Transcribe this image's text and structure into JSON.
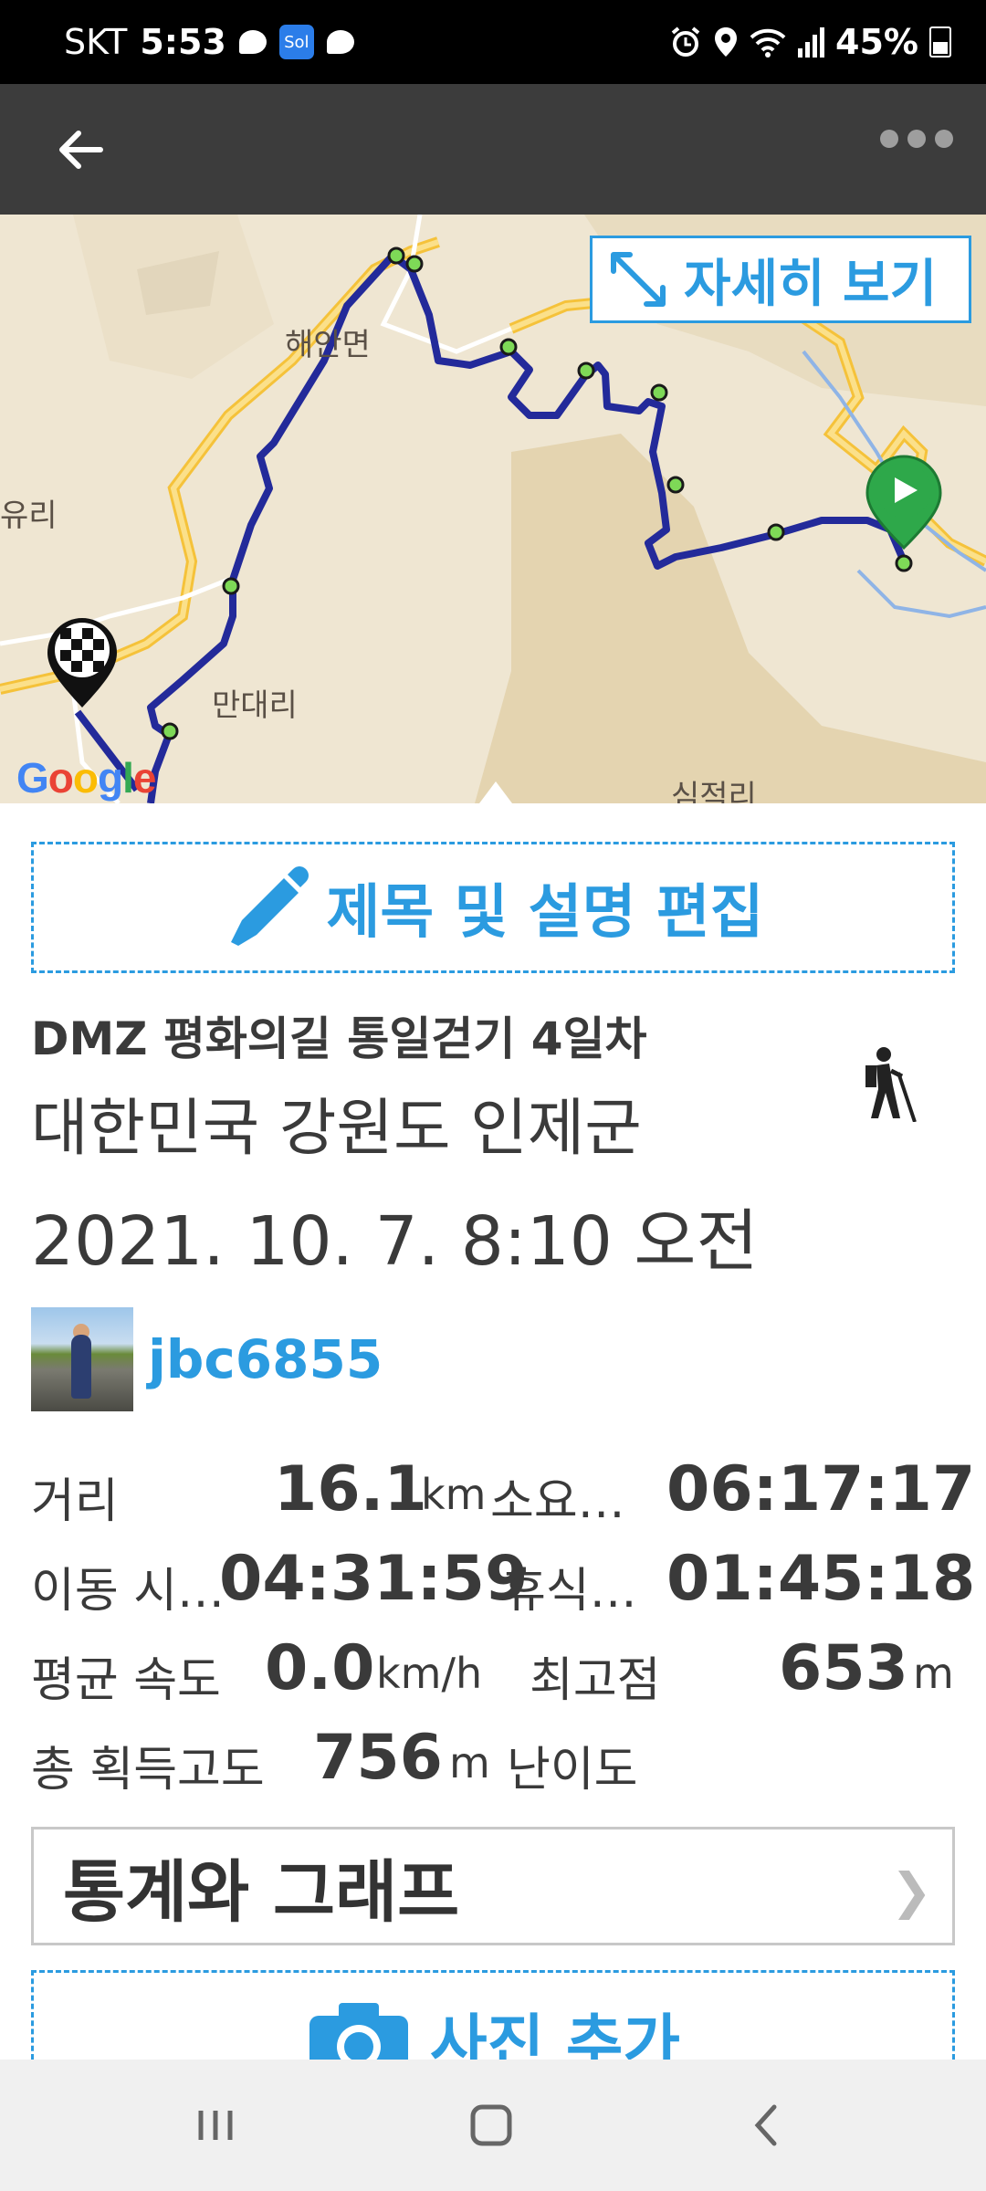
{
  "status_bar": {
    "carrier": "SKT",
    "time": "5:53",
    "app_badge": "Sol",
    "battery": "45%"
  },
  "app_bar": {
    "back_icon": "arrow-left-icon",
    "more_icon": "more-dots-icon"
  },
  "map": {
    "detail_button_label": "자세히 보기",
    "labels": {
      "haean": "해안면",
      "yuri": "유리",
      "mandae": "만대리",
      "simjeok": "심적리"
    },
    "google_logo": "Google",
    "route_color": "#232a9a",
    "start_marker_color": "#2ea84a",
    "end_marker": "checkered-flag"
  },
  "edit": {
    "label": "제목 및 설명 편집"
  },
  "trip": {
    "title": "DMZ 평화의길 통일걷기 4일차",
    "location": "대한민국 강원도 인제군",
    "date": "2021. 10. 7. 8:10 오전",
    "activity_icon": "hiker-icon"
  },
  "user": {
    "name": "jbc6855"
  },
  "stats": {
    "distance_label": "거리",
    "distance_value": "16.1",
    "distance_unit": "km",
    "duration_label": "소요…",
    "duration_value": "06:17:17",
    "moving_label": "이동 시…",
    "moving_value": "04:31:59",
    "rest_label": "휴식…",
    "rest_value": "01:45:18",
    "speed_label": "평균 속도",
    "speed_value": "0.0",
    "speed_unit": "km/h",
    "highest_label": "최고점",
    "highest_value": "653",
    "highest_unit": "m",
    "gain_label": "총 획득고도",
    "gain_value": "756",
    "gain_unit": "m",
    "difficulty_label": "난이도"
  },
  "stats_button": {
    "label": "통계와 그래프",
    "chevron": "❯"
  },
  "photo": {
    "label": "사진 추가"
  },
  "colors": {
    "accent": "#2b9be0",
    "appbar": "#3c3c3c",
    "text": "#3a3a3a"
  }
}
